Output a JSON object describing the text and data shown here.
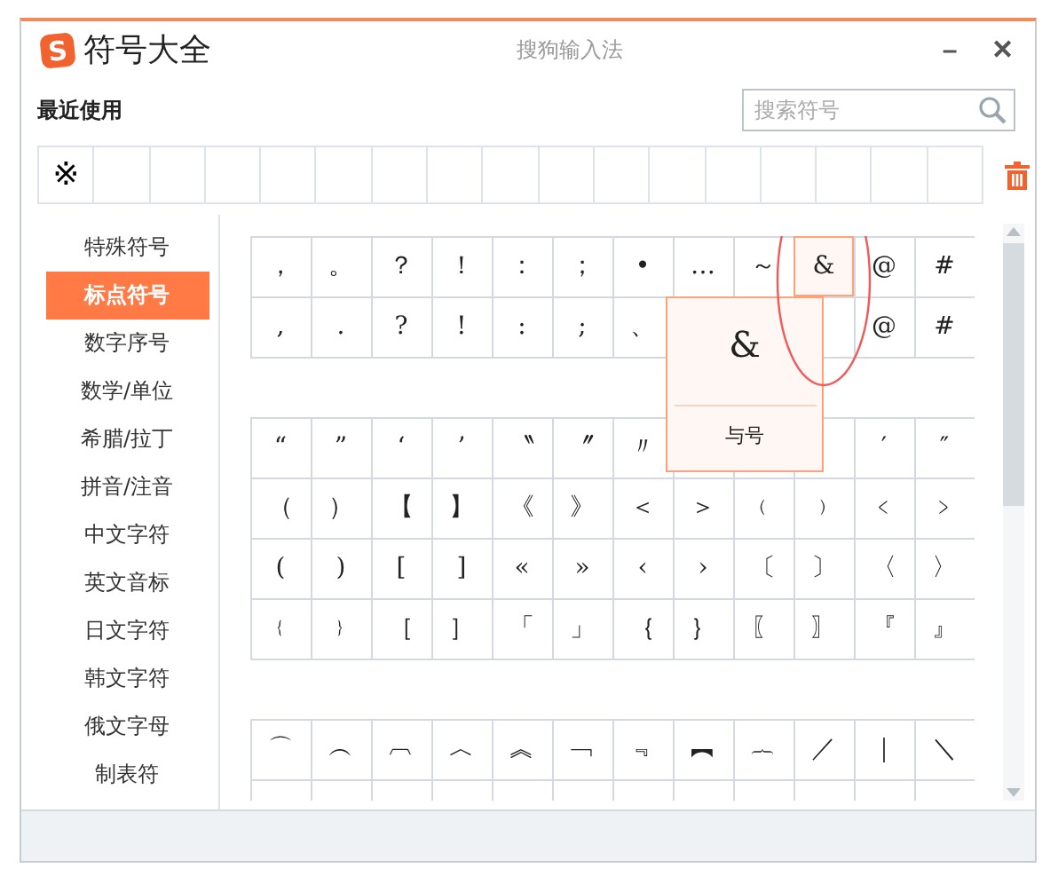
{
  "window": {
    "logo": "S",
    "title": "符号大全",
    "app_name": "搜狗输入法",
    "minimize": "–",
    "close": "✕"
  },
  "recent": {
    "heading": "最近使用",
    "search": {
      "placeholder": "搜索符号"
    },
    "cells": [
      "※",
      null,
      null,
      null,
      null,
      null,
      null,
      null,
      null,
      null,
      null,
      null,
      null,
      null,
      null,
      null,
      null
    ]
  },
  "sidebar": {
    "items": [
      {
        "label": "特殊符号",
        "selected": false
      },
      {
        "label": "标点符号",
        "selected": true
      },
      {
        "label": "数字序号",
        "selected": false
      },
      {
        "label": "数学/单位",
        "selected": false
      },
      {
        "label": "希腊/拉丁",
        "selected": false
      },
      {
        "label": "拼音/注音",
        "selected": false
      },
      {
        "label": "中文字符",
        "selected": false
      },
      {
        "label": "英文音标",
        "selected": false
      },
      {
        "label": "日文字符",
        "selected": false
      },
      {
        "label": "韩文字符",
        "selected": false
      },
      {
        "label": "俄文字母",
        "selected": false
      },
      {
        "label": "制表符",
        "selected": false
      }
    ]
  },
  "groups": [
    {
      "rows": [
        [
          {
            "symbol": "，",
            "selected": false
          },
          {
            "symbol": "。",
            "selected": false
          },
          {
            "symbol": "？",
            "selected": false
          },
          {
            "symbol": "！",
            "selected": false
          },
          {
            "symbol": "：",
            "selected": false
          },
          {
            "symbol": "；",
            "selected": false
          },
          {
            "symbol": "•",
            "selected": false
          },
          {
            "symbol": "…",
            "selected": false
          },
          {
            "symbol": "～",
            "selected": false
          },
          {
            "symbol": "&",
            "selected": true
          },
          {
            "symbol": "@",
            "selected": false
          },
          {
            "symbol": "#",
            "selected": false
          }
        ],
        [
          {
            "symbol": ",",
            "selected": false
          },
          {
            "symbol": ".",
            "selected": false
          },
          {
            "symbol": "?",
            "selected": false
          },
          {
            "symbol": "!",
            "selected": false
          },
          {
            "symbol": ":",
            "selected": false
          },
          {
            "symbol": ";",
            "selected": false
          },
          {
            "symbol": "、",
            "selected": false
          },
          null,
          null,
          null,
          {
            "symbol": "@",
            "selected": false
          },
          {
            "symbol": "#",
            "selected": false
          }
        ]
      ]
    },
    {
      "rows": [
        [
          {
            "symbol": "“",
            "selected": false
          },
          {
            "symbol": "”",
            "selected": false
          },
          {
            "symbol": "‘",
            "selected": false
          },
          {
            "symbol": "’",
            "selected": false
          },
          {
            "symbol": "〝",
            "selected": false
          },
          {
            "symbol": "〞",
            "selected": false
          },
          {
            "symbol": "〃",
            "selected": false
          },
          null,
          null,
          null,
          {
            "symbol": "′",
            "selected": false
          },
          {
            "symbol": "″",
            "selected": false
          }
        ],
        [
          {
            "symbol": "（",
            "selected": false
          },
          {
            "symbol": "）",
            "selected": false
          },
          {
            "symbol": "【",
            "selected": false
          },
          {
            "symbol": "】",
            "selected": false
          },
          {
            "symbol": "《",
            "selected": false
          },
          {
            "symbol": "》",
            "selected": false
          },
          {
            "symbol": "＜",
            "selected": false
          },
          {
            "symbol": "＞",
            "selected": false
          },
          {
            "symbol": "﹙",
            "selected": false
          },
          {
            "symbol": "﹚",
            "selected": false
          },
          {
            "symbol": "﹤",
            "selected": false
          },
          {
            "symbol": "﹥",
            "selected": false
          }
        ],
        [
          {
            "symbol": "(",
            "selected": false
          },
          {
            "symbol": ")",
            "selected": false
          },
          {
            "symbol": "[",
            "selected": false
          },
          {
            "symbol": "]",
            "selected": false
          },
          {
            "symbol": "«",
            "selected": false
          },
          {
            "symbol": "»",
            "selected": false
          },
          {
            "symbol": "‹",
            "selected": false
          },
          {
            "symbol": "›",
            "selected": false
          },
          {
            "symbol": "〔",
            "selected": false
          },
          {
            "symbol": "〕",
            "selected": false
          },
          {
            "symbol": "〈",
            "selected": false
          },
          {
            "symbol": "〉",
            "selected": false
          }
        ],
        [
          {
            "symbol": "﹛",
            "selected": false
          },
          {
            "symbol": "﹜",
            "selected": false
          },
          {
            "symbol": "［",
            "selected": false
          },
          {
            "symbol": "］",
            "selected": false
          },
          {
            "symbol": "「",
            "selected": false
          },
          {
            "symbol": "」",
            "selected": false
          },
          {
            "symbol": "｛",
            "selected": false
          },
          {
            "symbol": "｝",
            "selected": false
          },
          {
            "symbol": "〖",
            "selected": false
          },
          {
            "symbol": "〗",
            "selected": false
          },
          {
            "symbol": "『",
            "selected": false
          },
          {
            "symbol": "』",
            "selected": false
          }
        ]
      ]
    },
    {
      "rows": [
        [
          {
            "symbol": "⌒",
            "selected": false
          },
          {
            "symbol": "︵",
            "selected": false
          },
          {
            "symbol": "︹",
            "selected": false
          },
          {
            "symbol": "︿",
            "selected": false
          },
          {
            "symbol": "︽",
            "selected": false
          },
          {
            "symbol": "﹁",
            "selected": false
          },
          {
            "symbol": "﹃",
            "selected": false
          },
          {
            "symbol": "︻",
            "selected": false
          },
          {
            "symbol": "︷",
            "selected": false
          },
          {
            "symbol": "／",
            "selected": false
          },
          {
            "symbol": "｜",
            "selected": false
          },
          {
            "symbol": "＼",
            "selected": false
          }
        ],
        [
          null,
          null,
          null,
          null,
          null,
          null,
          null,
          null,
          null,
          null,
          null,
          null
        ]
      ]
    }
  ],
  "preview": {
    "symbol": "&",
    "name": "与号"
  }
}
